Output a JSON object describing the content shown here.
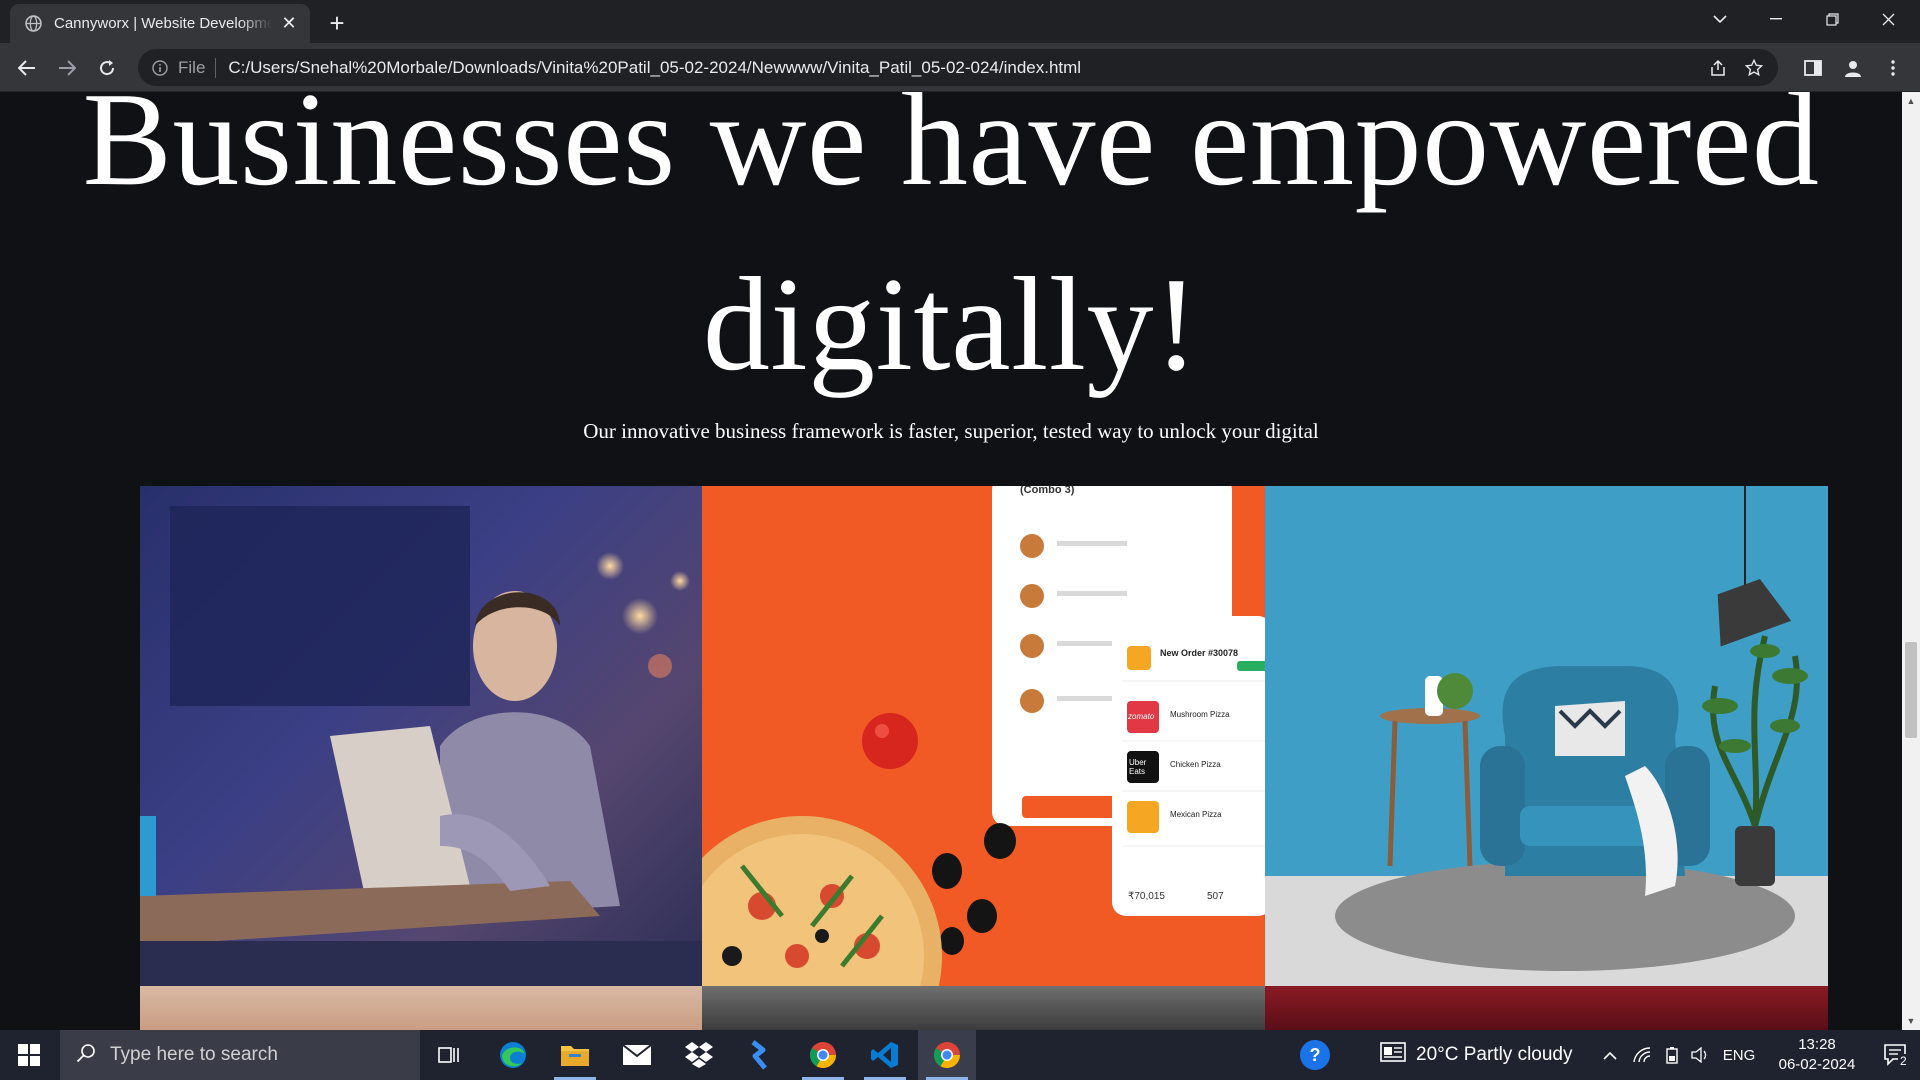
{
  "browser": {
    "tab_title": "Cannyworx | Website Development",
    "new_tab_label": "+",
    "address_prefix": "File",
    "url": "C:/Users/Snehal%20Morbale/Downloads/Vinita%20Patil_05-02-2024/Newwww/Vinita_Patil_05-02-024/index.html"
  },
  "page": {
    "headline_line1": "Businesses we have empowered",
    "headline_line2": "digitally!",
    "subtitle": "Our innovative business framework is faster, superior, tested way to unlock your digital"
  },
  "gallery": {
    "tiles": [
      {
        "name": "Man working on laptop"
      },
      {
        "name": "Pizza ordering app"
      },
      {
        "name": "Blue armchair interior"
      }
    ],
    "pizza_app": {
      "combo_title": "(Combo 3)",
      "new_order": "New Order #30078",
      "items": [
        "Mushroom Pizza",
        "Chicken Pizza",
        "Mexican Pizza"
      ],
      "brand_zomato": "zomato",
      "brand_uber_eats": "Uber Eats",
      "total_sales": "₹70,015",
      "total_orders": "507"
    }
  },
  "taskbar": {
    "search_placeholder": "Type here to search",
    "weather": "20°C  Partly cloudy",
    "language": "ENG",
    "time": "13:28",
    "date": "06-02-2024",
    "notification_count": "2"
  }
}
